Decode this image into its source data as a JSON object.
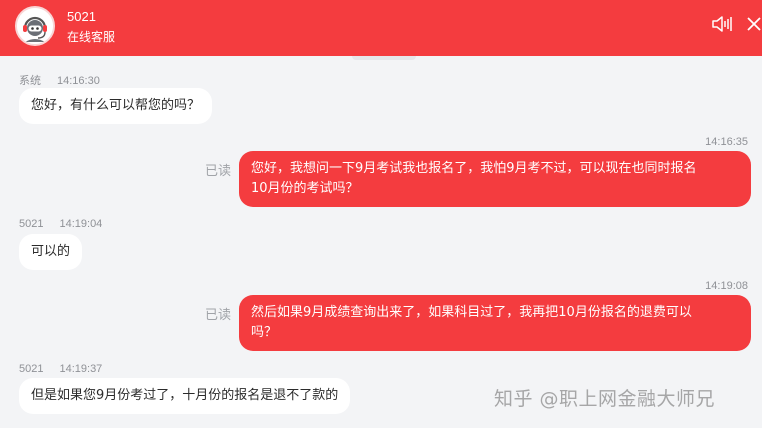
{
  "header": {
    "agent_name": "5021",
    "agent_status": "在线客服",
    "sound_icon": "speaker-icon",
    "close_icon": "close-icon",
    "accent_color": "#f43c3f"
  },
  "messages": [
    {
      "direction": "in",
      "sender": "系统",
      "time": "14:16:30",
      "text": "您好，有什么可以帮您的吗？"
    },
    {
      "direction": "out",
      "time": "14:16:35",
      "read": "已读",
      "lines": [
        "您好，我想问一下9月考试我也报名了，我怕9月考不过，可以现在也同时报名",
        "10月份的考试吗？"
      ]
    },
    {
      "direction": "in",
      "sender": "5021",
      "time": "14:19:04",
      "text": "可以的"
    },
    {
      "direction": "out",
      "time": "14:19:08",
      "read": "已读",
      "lines": [
        "然后如果9月成绩查询出来了，如果科目过了，我再把10月份报名的退费可以",
        "吗？"
      ]
    },
    {
      "direction": "in",
      "sender": "5021",
      "time": "14:19:37",
      "text": "但是如果您9月份考过了，十月份的报名是退不了款的"
    }
  ],
  "watermark": "知乎 @职上网金融大师兄"
}
